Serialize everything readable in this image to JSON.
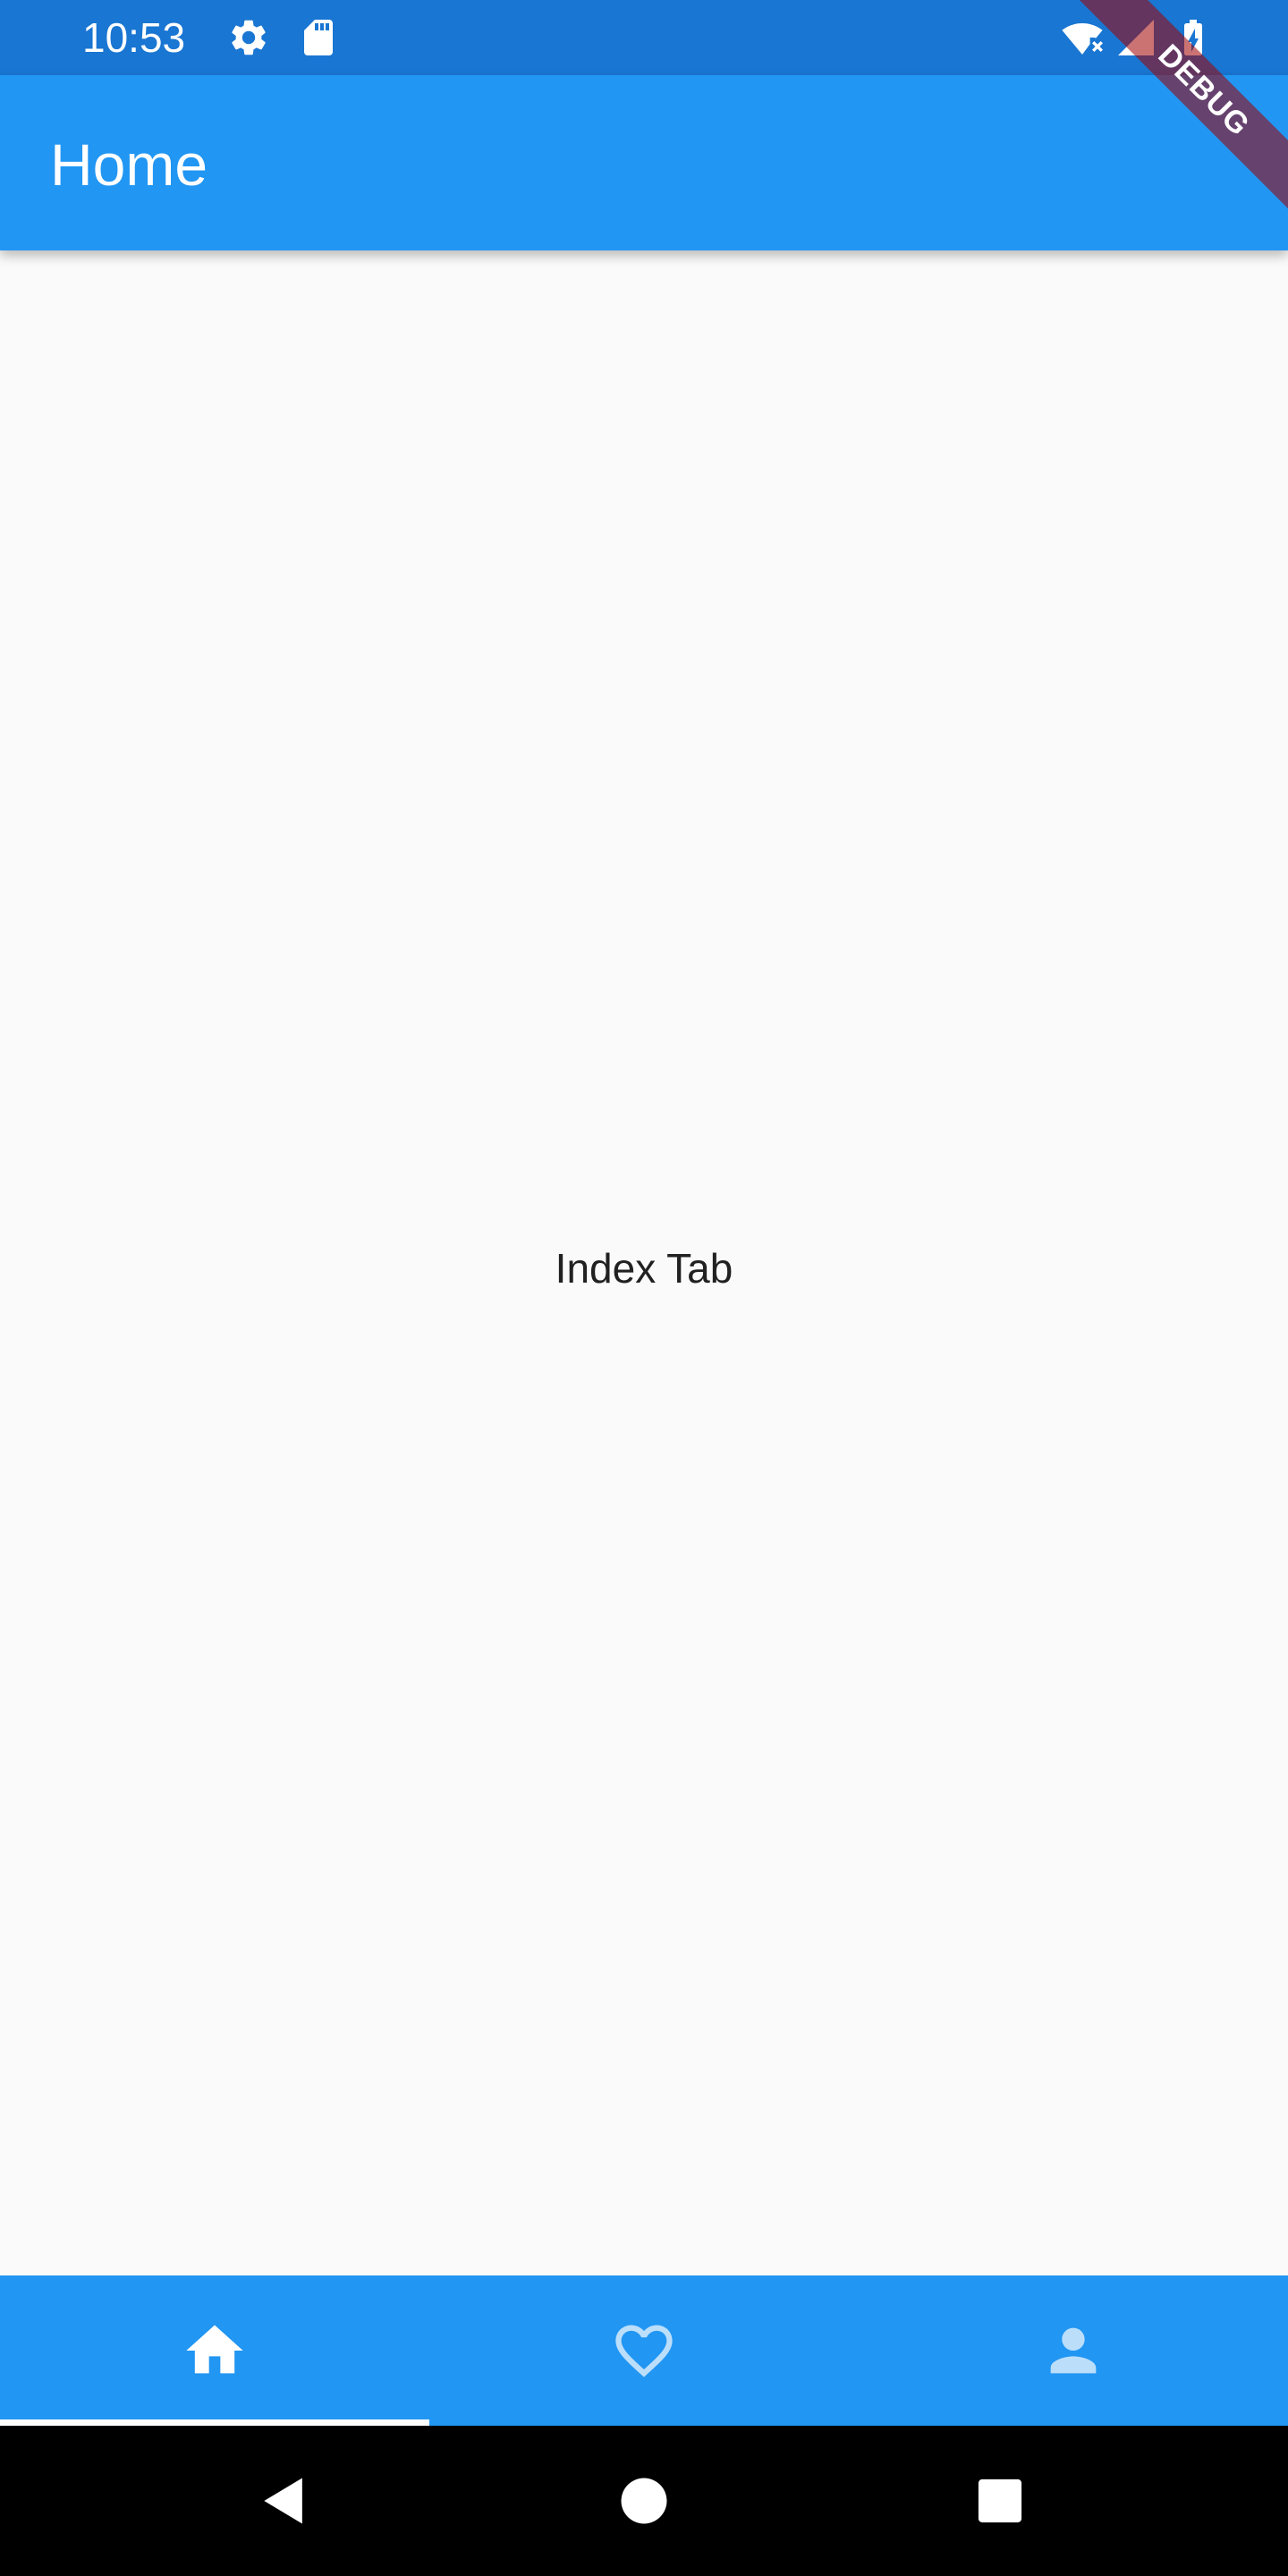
{
  "status_bar": {
    "time": "10:53",
    "icons_left": [
      "settings-icon",
      "sd-card-icon"
    ],
    "icons_right": [
      "wifi-no-internet-icon",
      "cell-signal-icon",
      "battery-charging-icon"
    ]
  },
  "app_bar": {
    "title": "Home"
  },
  "debug_banner": {
    "label": "DEBUG"
  },
  "body": {
    "text": "Index Tab"
  },
  "tabs": [
    {
      "icon": "home-icon",
      "selected": true
    },
    {
      "icon": "heart-outline-icon",
      "selected": false
    },
    {
      "icon": "person-icon",
      "selected": false
    }
  ],
  "nav_bar": {
    "buttons": [
      "back-icon",
      "home-circle-icon",
      "recents-icon"
    ]
  },
  "colors": {
    "primary": "#2196f3",
    "primary_dark": "#1976d2",
    "background": "#fafafa",
    "text": "#212121",
    "selected_tab_icon": "#ffffff",
    "unselected_tab_icon": "#bbdefb"
  }
}
